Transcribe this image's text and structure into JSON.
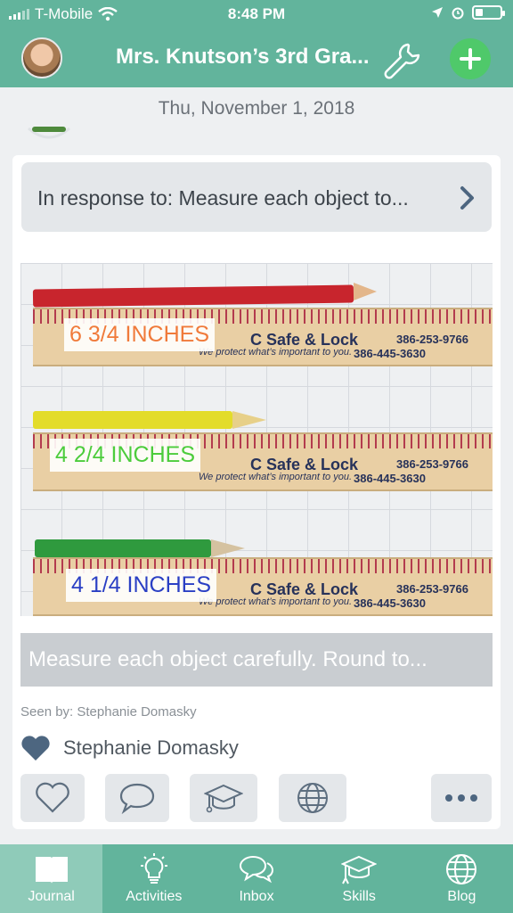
{
  "status_bar": {
    "carrier": "T-Mobile",
    "time": "8:48 PM"
  },
  "header": {
    "title": "Mrs. Knutson’s 3rd Gra..."
  },
  "feed": {
    "date": "Thu, November 1, 2018",
    "post": {
      "response_text": "In response to: Measure each object to...",
      "photo": {
        "ruler_brand": "C Safe & Lock",
        "ruler_phone_1": "386-253-9766",
        "ruler_phone_2": "386-445-3630",
        "ruler_tagline": "We protect what’s important to you.",
        "labels": [
          {
            "text": "6 3/4 INCHES",
            "color": "#f07a3a"
          },
          {
            "text": "4 2/4 INCHES",
            "color": "#4ccc3c"
          },
          {
            "text": "4 1/4 INCHES",
            "color": "#2a3fc4"
          }
        ],
        "pencil_colors": [
          "#c8252d",
          "#e3dc2a",
          "#2f9a3e"
        ]
      },
      "caption": "Measure each object carefully. Round to...",
      "seen_by": "Seen by: Stephanie Domasky",
      "liked_by": "Stephanie Domasky"
    }
  },
  "tabs": [
    {
      "label": "Journal",
      "icon": "journal-icon",
      "active": true
    },
    {
      "label": "Activities",
      "icon": "lightbulb-icon",
      "active": false
    },
    {
      "label": "Inbox",
      "icon": "chat-bubbles-icon",
      "active": false
    },
    {
      "label": "Skills",
      "icon": "grad-cap-icon",
      "active": false
    },
    {
      "label": "Blog",
      "icon": "globe-icon",
      "active": false
    }
  ],
  "colors": {
    "brand": "#62b49c",
    "add_button": "#4fc96a",
    "active_tab": "#8fcbb9"
  }
}
